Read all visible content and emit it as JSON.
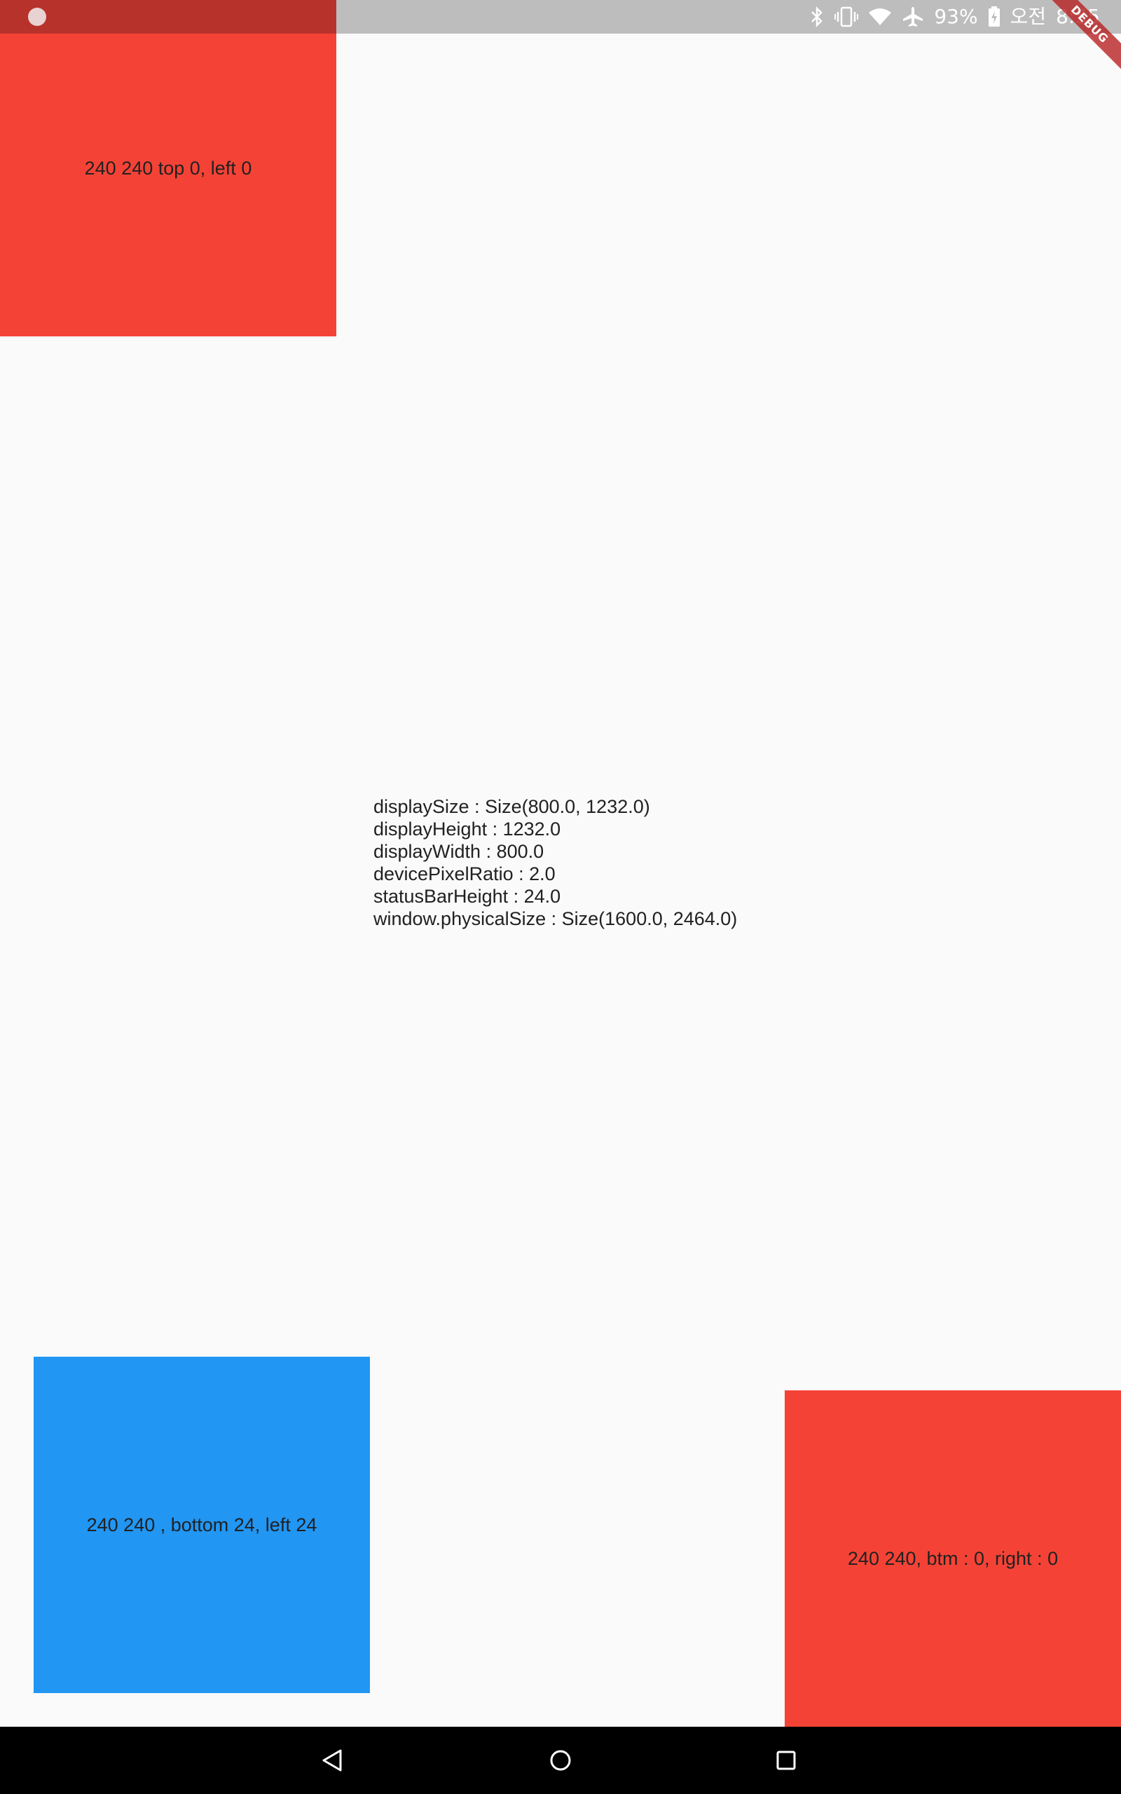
{
  "status_bar": {
    "battery": "93%",
    "ampm": "오전",
    "time": "8:55",
    "icons": [
      "bluetooth-icon",
      "vibrate-icon",
      "wifi-icon",
      "airplane-mode-icon",
      "battery-charging-icon"
    ]
  },
  "debug_banner": {
    "label": "DEBUG"
  },
  "boxes": {
    "top_left": {
      "label": "240 240 top 0, left 0",
      "color": "#f44336"
    },
    "bottom_left": {
      "label": "240 240 , bottom 24, left 24",
      "color": "#2196f3"
    },
    "bottom_right": {
      "label": "240 240, btm : 0, right : 0",
      "color": "#f44336"
    }
  },
  "info": {
    "lines": [
      "displaySize : Size(800.0, 1232.0)",
      "displayHeight : 1232.0",
      "displayWidth : 800.0",
      "devicePixelRatio : 2.0",
      "statusBarHeight : 24.0",
      "window.physicalSize : Size(1600.0, 2464.0)"
    ]
  },
  "nav_bar": {
    "buttons": [
      "back-icon",
      "home-icon",
      "recents-icon"
    ]
  }
}
